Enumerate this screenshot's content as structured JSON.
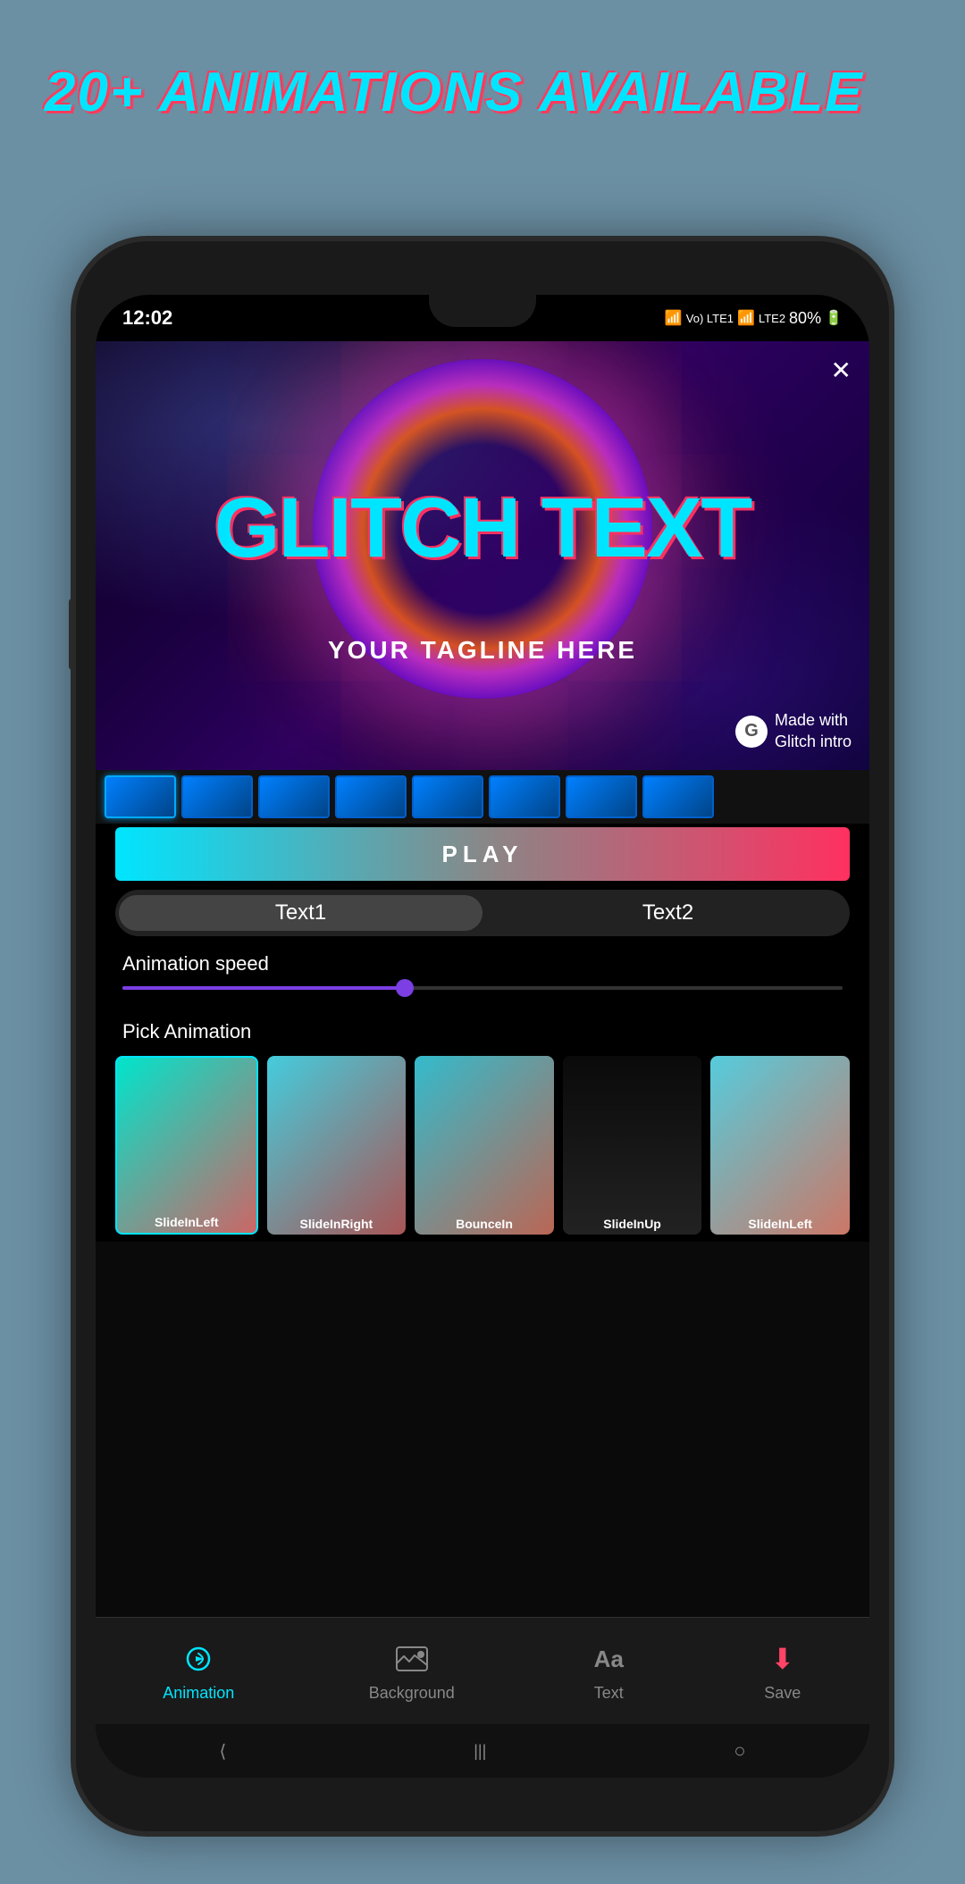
{
  "header": {
    "title": "20+ ANIMATIONS AVAILABLE"
  },
  "status_bar": {
    "time": "12:02",
    "battery": "80%",
    "signal_icons": "Vo) LTE1 Vo) LTE2"
  },
  "preview": {
    "glitch_text": "GLITCH TEXT",
    "tagline": "YOUR TAGLINE HERE",
    "watermark": "Made with\nGlitch intro"
  },
  "play_button": {
    "label": "PLAY"
  },
  "tabs": [
    {
      "id": "text1",
      "label": "Text1",
      "active": true
    },
    {
      "id": "text2",
      "label": "Text2",
      "active": false
    }
  ],
  "animation_speed": {
    "label": "Animation speed",
    "value": 40
  },
  "pick_animation": {
    "label": "Pick Animation",
    "cards": [
      {
        "id": 1,
        "label": "SlideInLeft",
        "selected": true
      },
      {
        "id": 2,
        "label": "SlideInRight",
        "selected": false
      },
      {
        "id": 3,
        "label": "BounceIn",
        "selected": false
      },
      {
        "id": 4,
        "label": "SlideInUp",
        "selected": false
      },
      {
        "id": 5,
        "label": "SlideInLeft",
        "selected": false
      }
    ]
  },
  "bottom_nav": [
    {
      "id": "animation",
      "label": "Animation",
      "icon": "⟳",
      "active": true
    },
    {
      "id": "background",
      "label": "Background",
      "icon": "🖼",
      "active": false
    },
    {
      "id": "text",
      "label": "Text",
      "icon": "Aa",
      "active": false
    },
    {
      "id": "save",
      "label": "Save",
      "icon": "↓",
      "active": false
    }
  ],
  "colors": {
    "accent_cyan": "#00e5ff",
    "accent_red": "#ff3060",
    "accent_purple": "#7b3fe4",
    "bg_dark": "#0a0a0a",
    "phone_bg": "#1a1a1a",
    "outer_bg": "#6b8fa3"
  }
}
